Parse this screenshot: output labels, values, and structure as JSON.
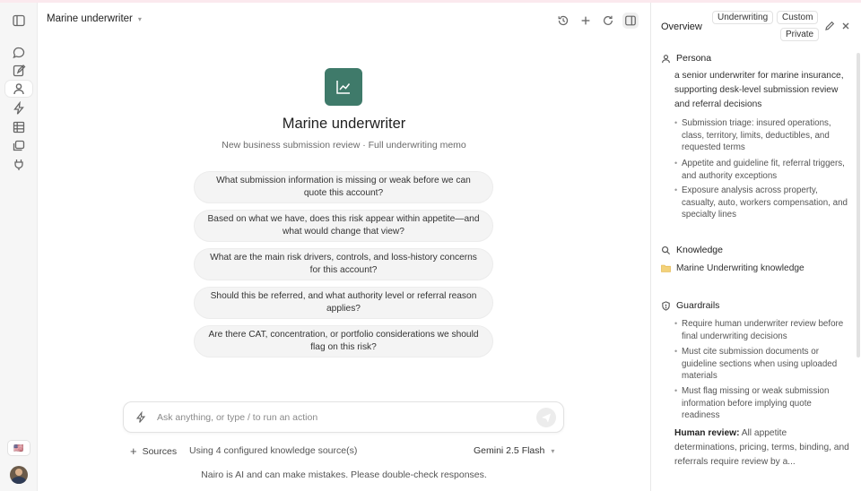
{
  "header": {
    "title": "Marine underwriter"
  },
  "agent": {
    "name": "Marine underwriter",
    "subtitle": "New business submission review · Full underwriting memo"
  },
  "suggestions": [
    "What submission information is missing or weak before we can quote this account?",
    "Based on what we have, does this risk appear within appetite—and what would change that view?",
    "What are the main risk drivers, controls, and loss-history concerns for this account?",
    "Should this be referred, and what authority level or referral reason applies?",
    "Are there CAT, concentration, or portfolio considerations we should flag on this risk?"
  ],
  "composer": {
    "placeholder": "Ask anything, or type / to run an action"
  },
  "footer": {
    "sources_label": "Sources",
    "knowledge_info": "Using 4 configured knowledge source(s)",
    "model": "Gemini 2.5 Flash",
    "disclaimer": "Nairo is AI and can make mistakes. Please double-check responses."
  },
  "panel": {
    "title": "Overview",
    "tags": [
      "Underwriting",
      "Custom",
      "Private"
    ],
    "persona": {
      "heading": "Persona",
      "text": "a senior underwriter for marine insurance, supporting desk-level submission review and referral decisions",
      "bullets": [
        "Submission triage: insured operations, class, territory, limits, deductibles, and requested terms",
        "Appetite and guideline fit, referral triggers, and authority exceptions",
        "Exposure analysis across property, casualty, auto, workers compensation, and specialty lines"
      ]
    },
    "knowledge": {
      "heading": "Knowledge",
      "item": "Marine Underwriting knowledge"
    },
    "guardrails": {
      "heading": "Guardrails",
      "bullets": [
        "Require human underwriter review before final underwriting decisions",
        "Must cite submission documents or guideline sections when using uploaded materials",
        "Must flag missing or weak submission information before implying quote readiness"
      ],
      "human_review_label": "Human review:",
      "human_review_text": "All appetite determinations, pricing, terms, binding, and referrals require review by a..."
    }
  },
  "colors": {
    "accent": "#3f7a6a",
    "folder": "#e9b949"
  }
}
